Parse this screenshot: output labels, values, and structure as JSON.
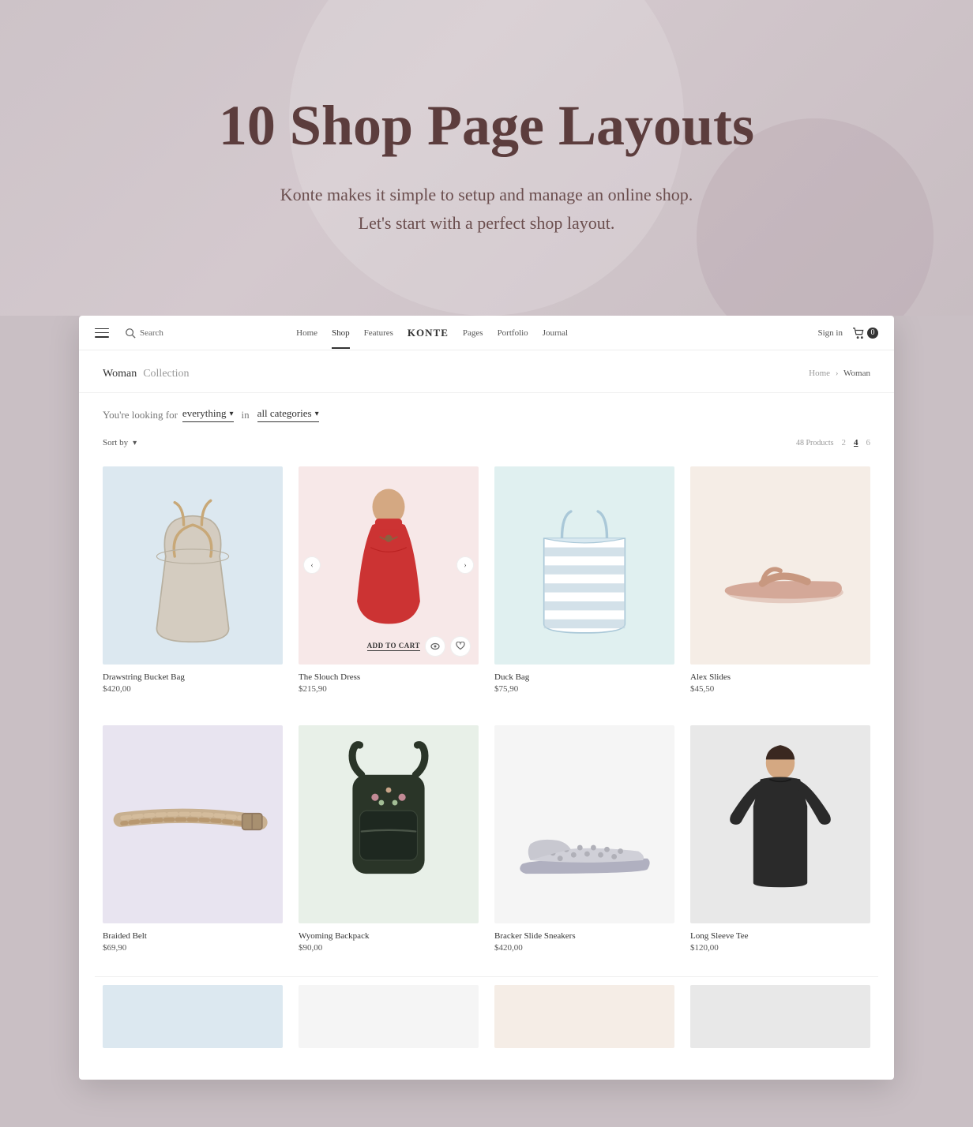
{
  "hero": {
    "title": "10 Shop Page Layouts",
    "subtitle_line1": "Konte makes it simple to setup and manage an online shop.",
    "subtitle_line2": "Let's start with a perfect shop layout."
  },
  "nav": {
    "menu_icon_label": "Menu",
    "search_label": "Search",
    "links": [
      {
        "label": "Home",
        "active": false
      },
      {
        "label": "Shop",
        "active": true
      },
      {
        "label": "Features",
        "active": false
      },
      {
        "label": "KONTE",
        "active": false,
        "brand": true
      },
      {
        "label": "Pages",
        "active": false
      },
      {
        "label": "Portfolio",
        "active": false
      },
      {
        "label": "Journal",
        "active": false
      }
    ],
    "signin_label": "Sign in",
    "cart_count": "0"
  },
  "page_header": {
    "title": "Woman",
    "collection": "Collection",
    "breadcrumb": {
      "home": "Home",
      "separator": "›",
      "current": "Woman"
    }
  },
  "filter": {
    "looking_for_label": "You're looking for",
    "everything_label": "everything",
    "in_label": "in",
    "all_categories_label": "all categories"
  },
  "sort_row": {
    "sort_by_label": "Sort by",
    "products_count": "48 Products",
    "grid_options": [
      "2",
      "4",
      "6"
    ],
    "active_grid": "4"
  },
  "products": [
    {
      "id": 1,
      "name": "Drawstring Bucket Bag",
      "price": "$420,00",
      "bg_class": "bg-light-blue",
      "shape": "bag",
      "has_carousel": false
    },
    {
      "id": 2,
      "name": "The Slouch Dress",
      "price": "$215,90",
      "bg_class": "bg-light-pink",
      "shape": "dress",
      "has_carousel": true,
      "add_to_cart": "ADD TO CART"
    },
    {
      "id": 3,
      "name": "Duck Bag",
      "price": "$75,90",
      "bg_class": "bg-light-cyan",
      "shape": "tote",
      "has_carousel": false
    },
    {
      "id": 4,
      "name": "Alex Slides",
      "price": "$45,50",
      "bg_class": "bg-light-peach",
      "shape": "sandal",
      "has_carousel": false
    },
    {
      "id": 5,
      "name": "Braided Belt",
      "price": "$69,90",
      "bg_class": "bg-light-lavender",
      "shape": "belt",
      "has_carousel": false
    },
    {
      "id": 6,
      "name": "Wyoming Backpack",
      "price": "$90,00",
      "bg_class": "bg-light-green",
      "shape": "backpack",
      "has_carousel": false
    },
    {
      "id": 7,
      "name": "Bracker Slide Sneakers",
      "price": "$420,00",
      "bg_class": "bg-white-tint",
      "shape": "sneaker",
      "has_carousel": false
    },
    {
      "id": 8,
      "name": "Long Sleeve Tee",
      "price": "$120,00",
      "bg_class": "bg-light-gray",
      "shape": "shirt",
      "has_carousel": false
    }
  ],
  "bottom_row_products": [
    {
      "id": 9,
      "bg_class": "bg-light-blue",
      "shape": "misc"
    },
    {
      "id": 10,
      "bg_class": "bg-white-tint",
      "shape": "misc"
    },
    {
      "id": 11,
      "bg_class": "bg-light-peach",
      "shape": "misc"
    },
    {
      "id": 12,
      "bg_class": "bg-light-gray",
      "shape": "misc"
    }
  ]
}
